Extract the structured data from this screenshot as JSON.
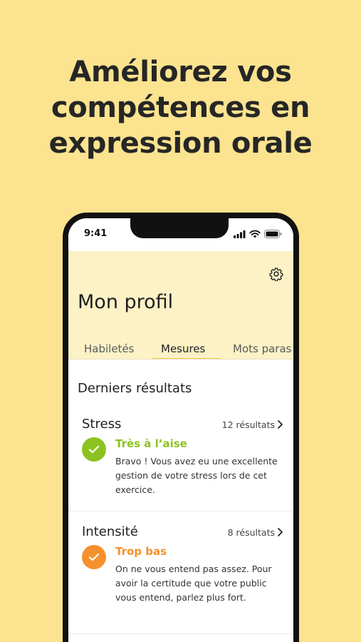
{
  "headline": {
    "line1": "Améliorez vos",
    "line2": "compétences en",
    "line3": "expression orale"
  },
  "status_bar": {
    "time": "9:41",
    "icons": [
      "signal-icon",
      "wifi-icon",
      "battery-icon"
    ]
  },
  "header": {
    "title": "Mon profil",
    "settings_icon": "gear-icon"
  },
  "tabs": [
    {
      "label": "Habiletés",
      "active": false
    },
    {
      "label": "Mesures",
      "active": true
    },
    {
      "label": "Mots paras",
      "active": false
    }
  ],
  "section": {
    "title": "Derniers résultats"
  },
  "results": [
    {
      "title": "Stress",
      "count": "12 résultats",
      "status": "Très à l’aise",
      "description": "Bravo ! Vous avez eu une excellente gestion de votre stress lors de cet exercice.",
      "color": "#8cc21f"
    },
    {
      "title": "Intensité",
      "count": "8 résultats",
      "status": "Trop bas",
      "description": "On ne vous entend pas assez. Pour avoir la certitude que votre public vous entend, parlez plus fort.",
      "color": "#f4912c"
    }
  ],
  "colors": {
    "background": "#fbe38f",
    "header_bg": "#fcf2c6",
    "tab_accent": "#f2c94c"
  }
}
